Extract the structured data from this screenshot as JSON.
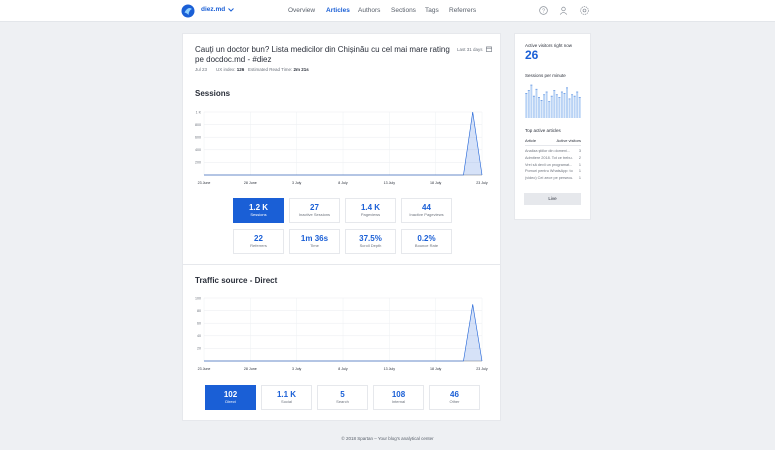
{
  "topbar": {
    "site": "diez.md",
    "nav": [
      {
        "label": "Overview",
        "active": false
      },
      {
        "label": "Articles",
        "active": true
      },
      {
        "label": "Authors",
        "active": false
      },
      {
        "label": "Sections",
        "active": false
      },
      {
        "label": "Tags",
        "active": false
      },
      {
        "label": "Referrers",
        "active": false
      }
    ],
    "icons": [
      "help-icon",
      "user-icon",
      "settings-icon"
    ]
  },
  "article": {
    "title": "Cauți un doctor bun? Lista medicilor din Chișinău cu cel mai mare rating pe docdoc.md - #diez",
    "date": "Jul 23",
    "ux_label": "UX index:",
    "ux_value": "126",
    "read_label": "Estimated Read Time:",
    "read_value": "2m 21s",
    "range": "Last 31 days"
  },
  "sessions": {
    "title": "Sessions",
    "tiles": [
      {
        "value": "1.2 K",
        "label": "Sessions",
        "selected": true
      },
      {
        "value": "27",
        "label": "Inactive Sessions",
        "selected": false
      },
      {
        "value": "1.4 K",
        "label": "Pageviews",
        "selected": false
      },
      {
        "value": "44",
        "label": "Inactive Pageviews",
        "selected": false
      },
      {
        "value": "22",
        "label": "Referrers",
        "selected": false
      },
      {
        "value": "1m 36s",
        "label": "Time",
        "selected": false
      },
      {
        "value": "37.5%",
        "label": "Scroll Depth",
        "selected": false
      },
      {
        "value": "0.2%",
        "label": "Bounce Rate",
        "selected": false
      }
    ]
  },
  "traffic": {
    "title": "Traffic source - Direct",
    "tiles": [
      {
        "value": "102",
        "label": "Direct",
        "selected": true
      },
      {
        "value": "1.1 K",
        "label": "Social",
        "selected": false
      },
      {
        "value": "5",
        "label": "Search",
        "selected": false
      },
      {
        "value": "108",
        "label": "Internal",
        "selected": false
      },
      {
        "value": "46",
        "label": "Other",
        "selected": false
      }
    ]
  },
  "chart_data": [
    {
      "type": "area",
      "name": "sessions-chart",
      "x": [
        "23 June",
        "24 June",
        "25 June",
        "26 June",
        "27 June",
        "28 June",
        "29 June",
        "30 June",
        "1 July",
        "2 July",
        "3 July",
        "4 July",
        "5 July",
        "6 July",
        "7 July",
        "8 July",
        "9 July",
        "10 July",
        "11 July",
        "12 July",
        "13 July",
        "14 July",
        "15 July",
        "16 July",
        "17 July",
        "18 July",
        "19 July",
        "20 July",
        "21 July",
        "22 July",
        "23 July"
      ],
      "xticks": [
        "23 June",
        "28 June",
        "3 July",
        "8 July",
        "13 July",
        "18 July",
        "23 July"
      ],
      "yticks": [
        "200",
        "400",
        "600",
        "800",
        "1 K"
      ],
      "values": [
        0,
        0,
        0,
        0,
        0,
        0,
        0,
        0,
        0,
        0,
        0,
        0,
        0,
        0,
        0,
        0,
        0,
        0,
        0,
        0,
        0,
        0,
        0,
        0,
        0,
        0,
        0,
        0,
        0,
        1000,
        0
      ],
      "ylim": [
        0,
        1000
      ],
      "grid": true,
      "color": "#1a5fd6"
    },
    {
      "type": "area",
      "name": "traffic-chart",
      "x": [
        "23 June",
        "24 June",
        "25 June",
        "26 June",
        "27 June",
        "28 June",
        "29 June",
        "30 June",
        "1 July",
        "2 July",
        "3 July",
        "4 July",
        "5 July",
        "6 July",
        "7 July",
        "8 July",
        "9 July",
        "10 July",
        "11 July",
        "12 July",
        "13 July",
        "14 July",
        "15 July",
        "16 July",
        "17 July",
        "18 July",
        "19 July",
        "20 July",
        "21 July",
        "22 July",
        "23 July"
      ],
      "xticks": [
        "23 June",
        "28 June",
        "3 July",
        "8 July",
        "13 July",
        "18 July",
        "23 July"
      ],
      "yticks": [
        "20",
        "40",
        "60",
        "80",
        "100"
      ],
      "values": [
        0,
        0,
        0,
        0,
        0,
        0,
        0,
        0,
        0,
        0,
        0,
        0,
        0,
        0,
        0,
        0,
        0,
        0,
        0,
        0,
        0,
        0,
        0,
        0,
        0,
        0,
        0,
        0,
        0,
        90,
        0
      ],
      "ylim": [
        0,
        100
      ],
      "grid": true,
      "color": "#1a5fd6"
    }
  ],
  "sidebar": {
    "active_label": "Active visitors right now",
    "active_value": "26",
    "spm_label": "Sessions per minute",
    "spm_values": [
      18,
      20,
      24,
      16,
      21,
      15,
      13,
      17,
      19,
      12,
      16,
      20,
      17,
      15,
      19,
      18,
      22,
      14,
      17,
      16,
      19,
      15
    ],
    "top_label": "Top active articles",
    "col_article": "Article",
    "col_visitors": "Active visitors",
    "articles": [
      {
        "name": "Analiza ştiilor din domeni...",
        "count": "3"
      },
      {
        "name": "Admitere 2018. Tot ce trebu...",
        "count": "2"
      },
      {
        "name": "Vrei să devii un programat...",
        "count": "1"
      },
      {
        "name": "Pomuri pentru WhatsApp: top...",
        "count": "1"
      },
      {
        "name": "(video) Cei zece pe persecu...",
        "count": "1"
      }
    ],
    "live_label": "Live"
  },
  "footer": "© 2018 Spartan – Your blog's analytical center"
}
